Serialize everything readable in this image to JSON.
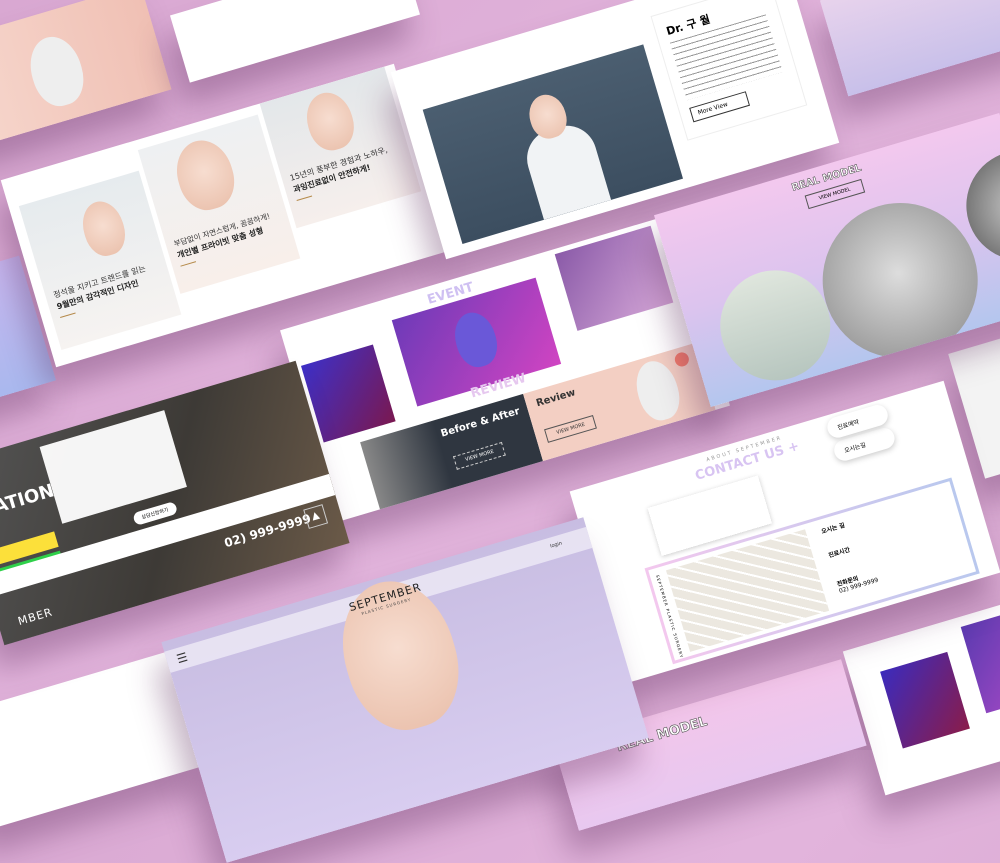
{
  "colors": {
    "background": "#deaed8",
    "accent_pink": "#f0bfe6",
    "accent_blue": "#b9c8ee",
    "dark": "#2f3640"
  },
  "beauty_cards": [
    {
      "line1": "정석을 지키고 트렌드를 읽는",
      "line2": "9월만의 감각적인 디자인"
    },
    {
      "line1": "부담없이 자연스럽게, 꼼꼼하게!",
      "line2": "개인별 프라이빗 맞춤 성형"
    },
    {
      "line1": "15년의 풍부한 경험과 노하우,",
      "line2": "과잉진료없이 안전하게!"
    }
  ],
  "doctor": {
    "name": "Dr. 구 월",
    "more": "More View"
  },
  "event": {
    "title": "EVENT",
    "prev": "←",
    "next": "→"
  },
  "review": {
    "title": "REVIEW",
    "before_after": "Before & After",
    "review_heading": "Review",
    "view_more": "VIEW MORE"
  },
  "consultation": {
    "title": "LTATION",
    "phone": "02) 999-9999",
    "brand": "MBER",
    "submit": "상담신청하기"
  },
  "real_model": {
    "title": "REAL MODEL",
    "button": "VIEW MODEL"
  },
  "contact": {
    "eyebrow": "ABOUT SEPTEMBER",
    "title": "CONTACT US +",
    "btn1": "진료예약",
    "btn2": "오시는길",
    "vertical": "SEPTEMBER PLASTIC SURGERY",
    "directions": "오시는 길",
    "hours": "진료시간",
    "phone_label": "전화문의",
    "phone": "02) 999-9999"
  },
  "hero": {
    "brand": "SEPTEMBER",
    "sub": "PLASTIC SURGERY",
    "login": "login"
  },
  "bottom_real_model": "REAL MODEL"
}
